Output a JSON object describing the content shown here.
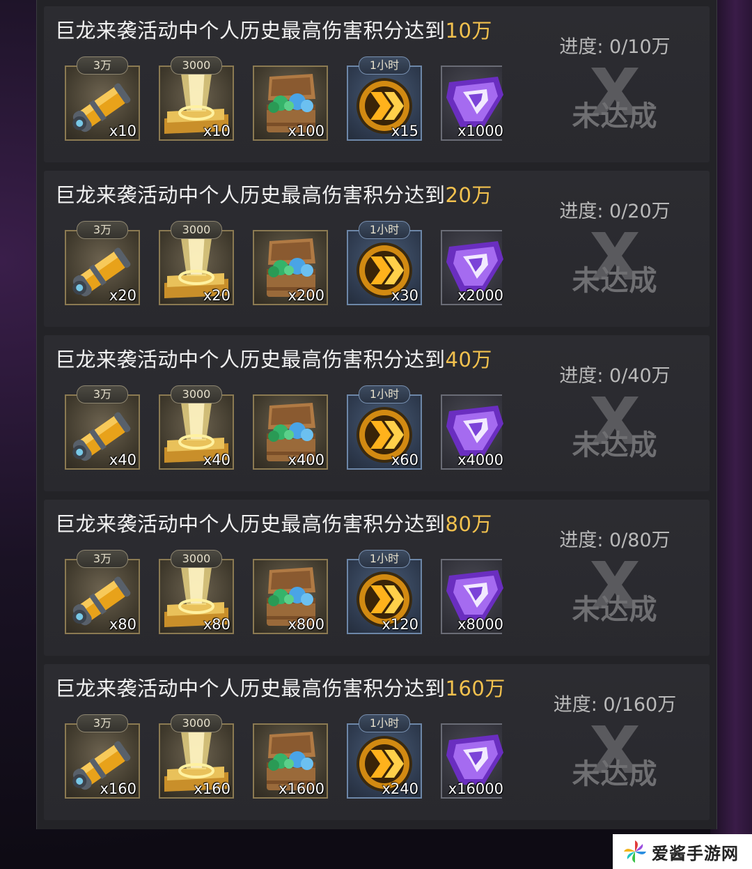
{
  "rows": [
    {
      "title_prefix": "巨龙来袭活动中个人历史最高伤害积分达到",
      "title_amount": "10万",
      "progress": "进度: 0/10万",
      "status": "未达成",
      "rewards": [
        {
          "icon": "ammo-canister-icon",
          "tag": "3万",
          "qty": "x10"
        },
        {
          "icon": "golden-beam-icon",
          "tag": "3000",
          "qty": "x10"
        },
        {
          "icon": "gem-chest-icon",
          "tag": "",
          "qty": "x100"
        },
        {
          "icon": "speedup-chevron-icon",
          "tag": "1小时",
          "qty": "x15"
        },
        {
          "icon": "purple-crystal-icon",
          "tag": "",
          "qty": "x1000"
        }
      ]
    },
    {
      "title_prefix": "巨龙来袭活动中个人历史最高伤害积分达到",
      "title_amount": "20万",
      "progress": "进度: 0/20万",
      "status": "未达成",
      "rewards": [
        {
          "icon": "ammo-canister-icon",
          "tag": "3万",
          "qty": "x20"
        },
        {
          "icon": "golden-beam-icon",
          "tag": "3000",
          "qty": "x20"
        },
        {
          "icon": "gem-chest-icon",
          "tag": "",
          "qty": "x200"
        },
        {
          "icon": "speedup-chevron-icon",
          "tag": "1小时",
          "qty": "x30"
        },
        {
          "icon": "purple-crystal-icon",
          "tag": "",
          "qty": "x2000"
        }
      ]
    },
    {
      "title_prefix": "巨龙来袭活动中个人历史最高伤害积分达到",
      "title_amount": "40万",
      "progress": "进度: 0/40万",
      "status": "未达成",
      "rewards": [
        {
          "icon": "ammo-canister-icon",
          "tag": "3万",
          "qty": "x40"
        },
        {
          "icon": "golden-beam-icon",
          "tag": "3000",
          "qty": "x40"
        },
        {
          "icon": "gem-chest-icon",
          "tag": "",
          "qty": "x400"
        },
        {
          "icon": "speedup-chevron-icon",
          "tag": "1小时",
          "qty": "x60"
        },
        {
          "icon": "purple-crystal-icon",
          "tag": "",
          "qty": "x4000"
        }
      ]
    },
    {
      "title_prefix": "巨龙来袭活动中个人历史最高伤害积分达到",
      "title_amount": "80万",
      "progress": "进度: 0/80万",
      "status": "未达成",
      "rewards": [
        {
          "icon": "ammo-canister-icon",
          "tag": "3万",
          "qty": "x80"
        },
        {
          "icon": "golden-beam-icon",
          "tag": "3000",
          "qty": "x80"
        },
        {
          "icon": "gem-chest-icon",
          "tag": "",
          "qty": "x800"
        },
        {
          "icon": "speedup-chevron-icon",
          "tag": "1小时",
          "qty": "x120"
        },
        {
          "icon": "purple-crystal-icon",
          "tag": "",
          "qty": "x8000"
        }
      ]
    },
    {
      "title_prefix": "巨龙来袭活动中个人历史最高伤害积分达到",
      "title_amount": "160万",
      "progress": "进度: 0/160万",
      "status": "未达成",
      "rewards": [
        {
          "icon": "ammo-canister-icon",
          "tag": "3万",
          "qty": "x160"
        },
        {
          "icon": "golden-beam-icon",
          "tag": "3000",
          "qty": "x160"
        },
        {
          "icon": "gem-chest-icon",
          "tag": "",
          "qty": "x1600"
        },
        {
          "icon": "speedup-chevron-icon",
          "tag": "1小时",
          "qty": "x240"
        },
        {
          "icon": "purple-crystal-icon",
          "tag": "",
          "qty": "x16000"
        }
      ]
    }
  ],
  "watermark": {
    "text": "爱酱手游网",
    "icon": "pinwheel-logo-icon"
  },
  "colors": {
    "title_amount": "#f2c14e",
    "status_gray": "#6f6f72",
    "panel_bg": "#232327"
  }
}
